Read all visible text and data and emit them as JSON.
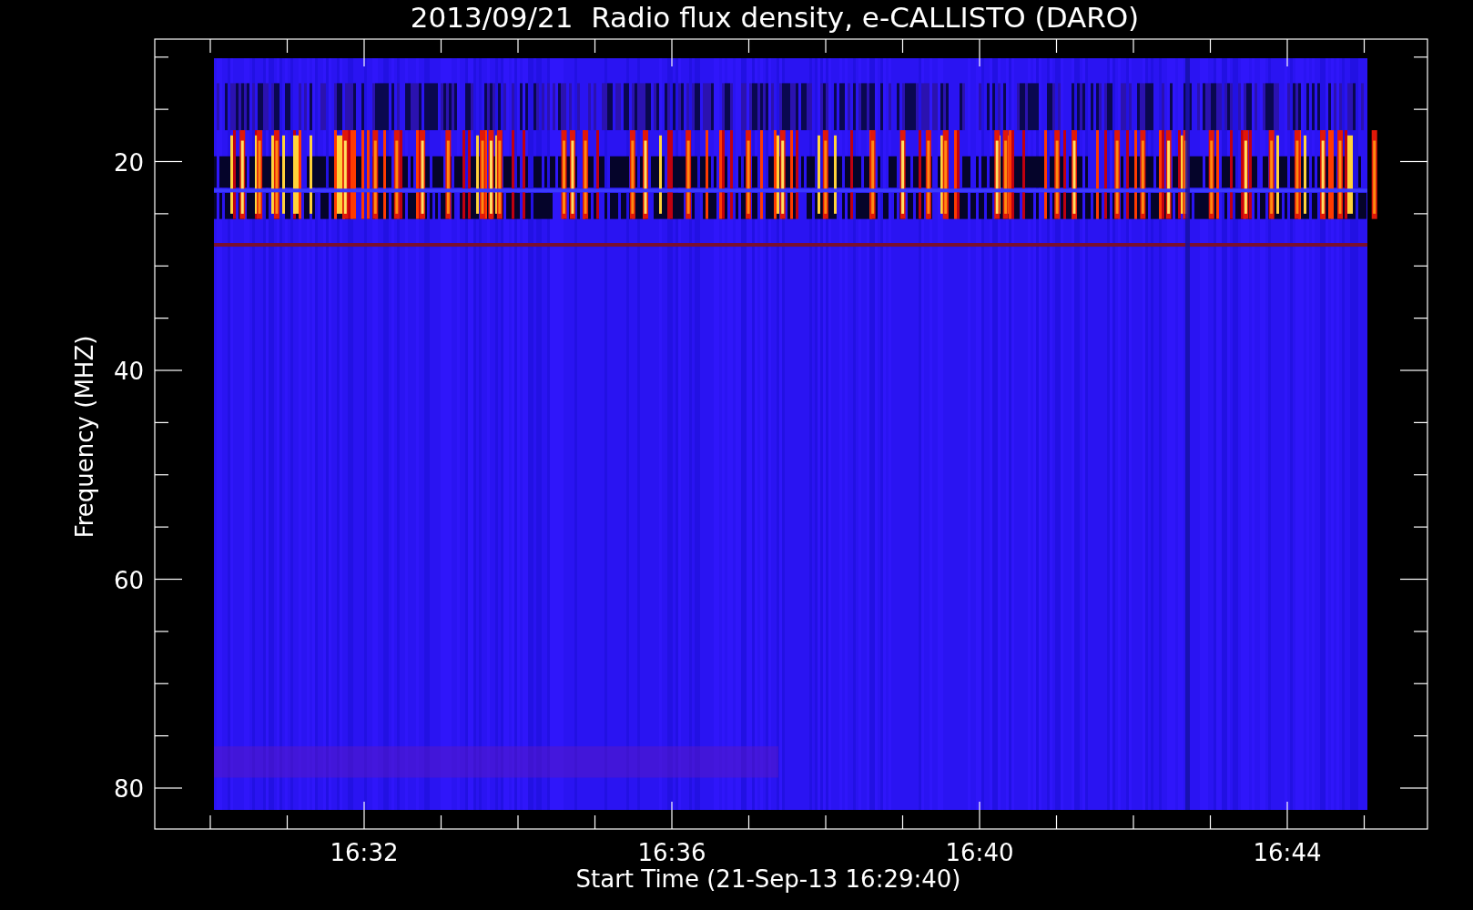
{
  "title": "2013/09/21  Radio flux density, e-CALLISTO (DARO)",
  "y_axis": {
    "label": "Frequency (MHZ)",
    "ticks": [
      "20",
      "40",
      "60",
      "80"
    ]
  },
  "x_axis": {
    "label": "Start Time (21-Sep-13 16:29:40)",
    "ticks": [
      "16:32",
      "16:36",
      "16:40",
      "16:44"
    ]
  }
}
